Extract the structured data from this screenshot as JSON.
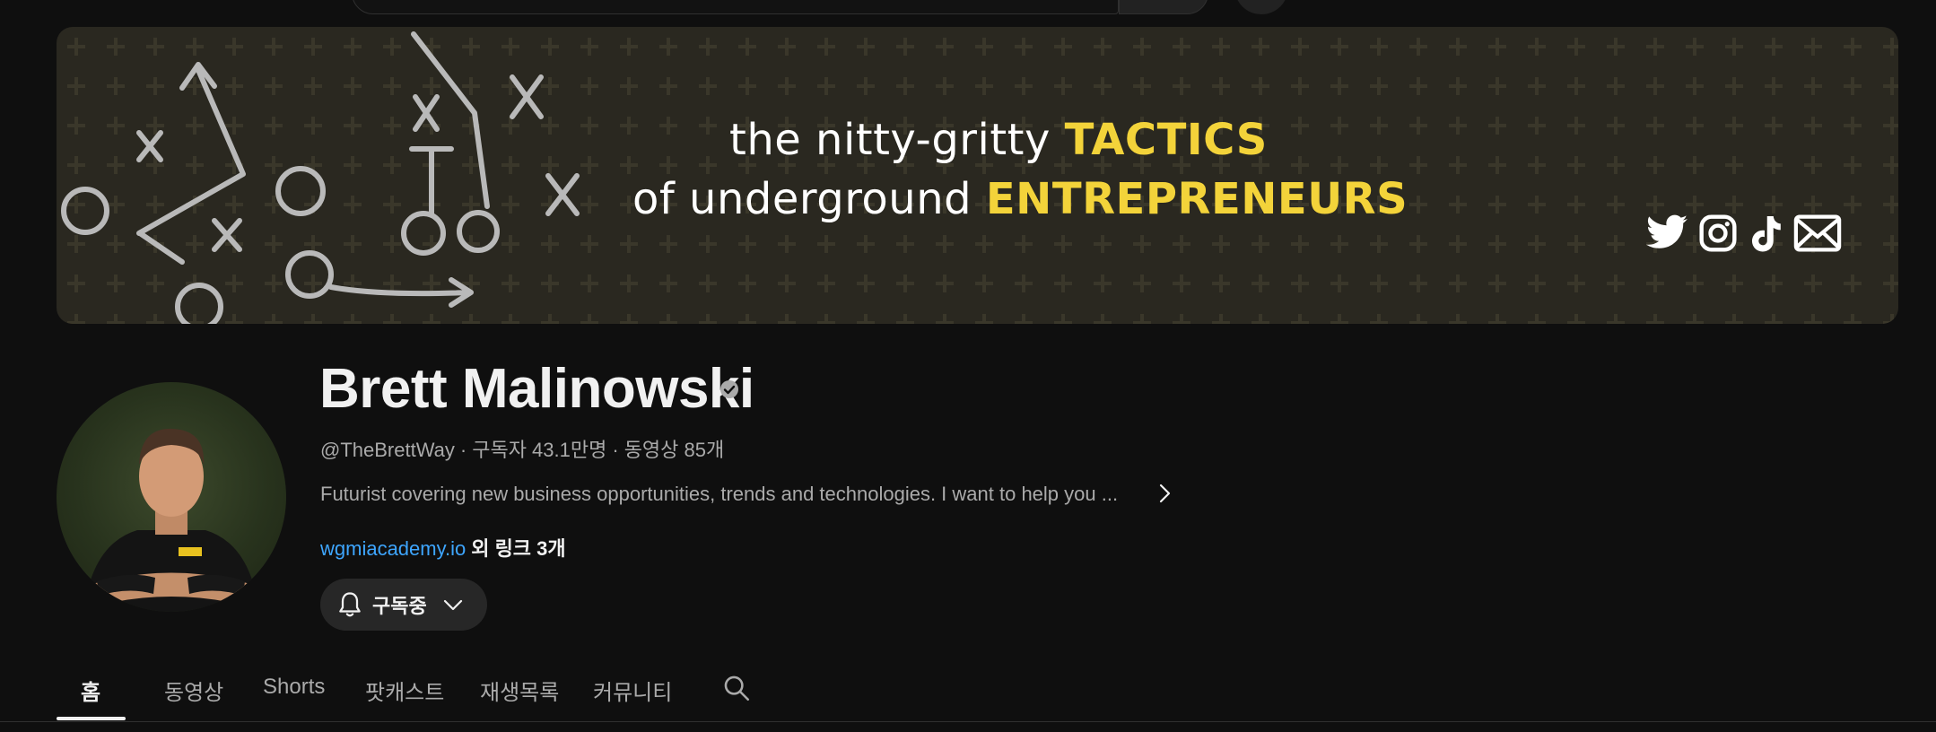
{
  "banner": {
    "line1_text": "the nitty-gritty",
    "line1_accent": "TACTICS",
    "line2_text": "of underground",
    "line2_accent": "ENTREPRENEURS",
    "accent_color": "#f3d33a",
    "social_icons": [
      "twitter-icon",
      "instagram-icon",
      "tiktok-icon",
      "email-icon"
    ]
  },
  "channel": {
    "name": "Brett Malinowski",
    "handle": "@TheBrettWay",
    "subscribers": "구독자 43.1만명",
    "videos": "동영상 85개",
    "description": "Futurist covering new business opportunities, trends and technologies. I want to help you ...",
    "link_primary": "wgmiacademy.io",
    "link_more": "외 링크 3개",
    "subscribe_label": "구독중"
  },
  "tabs": [
    {
      "label": "홈",
      "active": true
    },
    {
      "label": "동영상",
      "active": false
    },
    {
      "label": "Shorts",
      "active": false
    },
    {
      "label": "팟캐스트",
      "active": false
    },
    {
      "label": "재생목록",
      "active": false
    },
    {
      "label": "커뮤니티",
      "active": false
    }
  ],
  "colors": {
    "background": "#0f0f0f",
    "link": "#3ea6ff",
    "text_secondary": "#aaaaaa"
  }
}
